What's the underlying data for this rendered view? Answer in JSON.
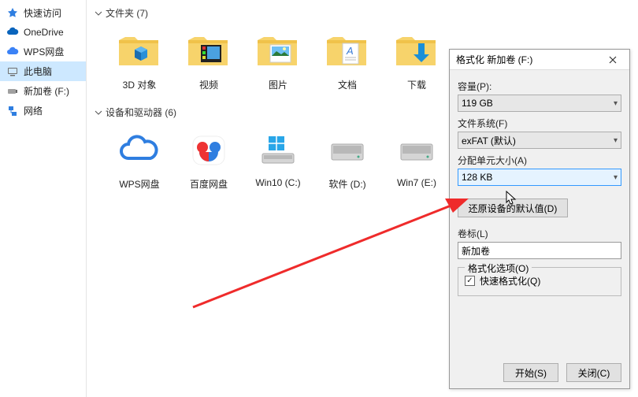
{
  "sidebar": {
    "items": [
      {
        "label": "快速访问"
      },
      {
        "label": "OneDrive"
      },
      {
        "label": "WPS网盘"
      },
      {
        "label": "此电脑"
      },
      {
        "label": "新加卷 (F:)"
      },
      {
        "label": "网络"
      }
    ]
  },
  "sections": {
    "folders": {
      "title": "文件夹 (7)"
    },
    "devices": {
      "title": "设备和驱动器 (6)"
    }
  },
  "folders": [
    {
      "label": "3D 对象"
    },
    {
      "label": "视频"
    },
    {
      "label": "图片"
    },
    {
      "label": "文档"
    },
    {
      "label": "下载"
    }
  ],
  "drives": [
    {
      "label": "WPS网盘"
    },
    {
      "label": "百度网盘"
    },
    {
      "label": "Win10 (C:)"
    },
    {
      "label": "软件 (D:)"
    },
    {
      "label": "Win7 (E:)"
    }
  ],
  "dialog": {
    "title": "格式化 新加卷 (F:)",
    "capacity_label": "容量(P):",
    "capacity_value": "119 GB",
    "filesystem_label": "文件系统(F)",
    "filesystem_value": "exFAT (默认)",
    "allocation_label": "分配单元大小(A)",
    "allocation_value": "128 KB",
    "restore_defaults": "还原设备的默认值(D)",
    "volume_label": "卷标(L)",
    "volume_value": "新加卷",
    "options_label": "格式化选项(O)",
    "quick_format": "快速格式化(Q)",
    "start": "开始(S)",
    "close": "关闭(C)"
  }
}
